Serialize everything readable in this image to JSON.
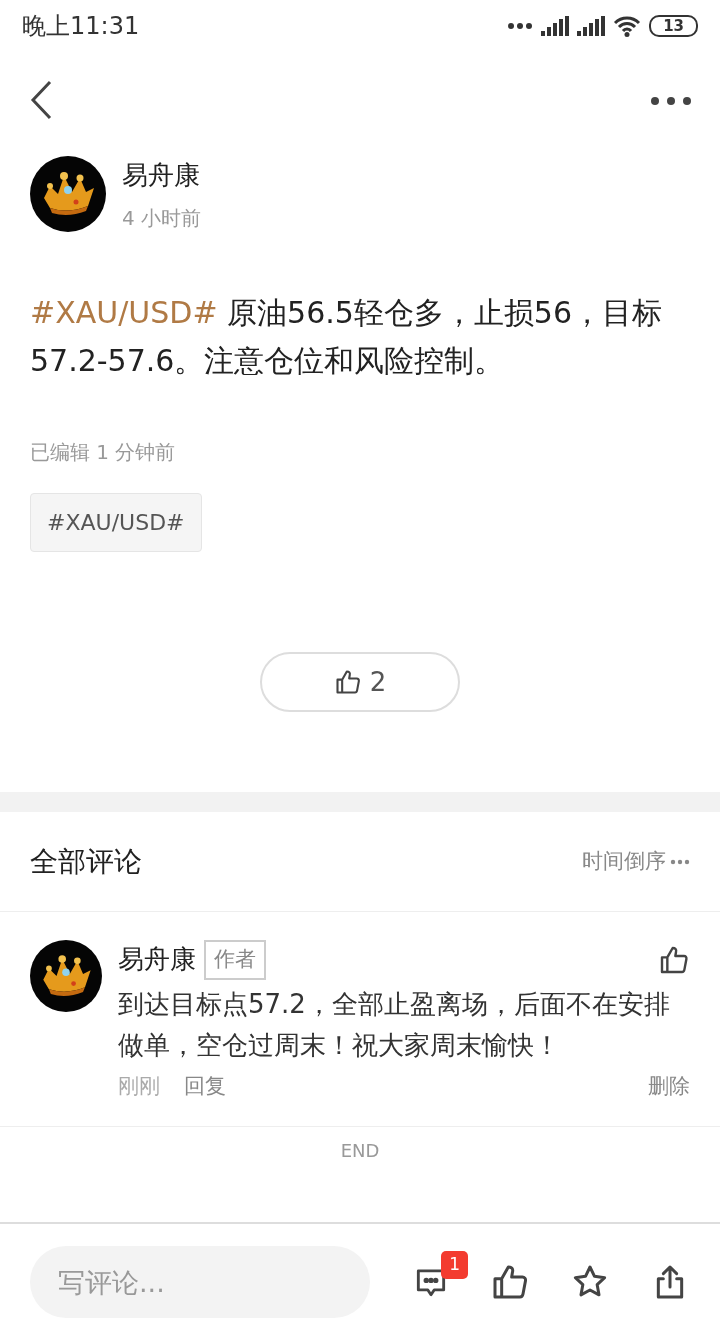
{
  "status_bar": {
    "time": "晚上11:31",
    "battery": "13"
  },
  "post": {
    "author": "易舟康",
    "time": "4 小时前",
    "hashtag": "#XAU/USD#",
    "text": " 原油56.5轻仓多，止损56，目标57.2-57.6。注意仓位和风险控制。",
    "edited": "已编辑 1 分钟前",
    "tags": [
      "#XAU/USD#"
    ],
    "likes": "2"
  },
  "comments_section": {
    "title": "全部评论",
    "sort": "时间倒序",
    "comments": [
      {
        "author": "易舟康",
        "badge": "作者",
        "text": "到达目标点57.2，全部止盈离场，后面不在安排做单，空仓过周末！祝大家周末愉快！",
        "time": "刚刚",
        "reply": "回复",
        "delete": "删除"
      }
    ],
    "end": "END"
  },
  "bottom_bar": {
    "placeholder": "写评论...",
    "comment_count": "1"
  }
}
